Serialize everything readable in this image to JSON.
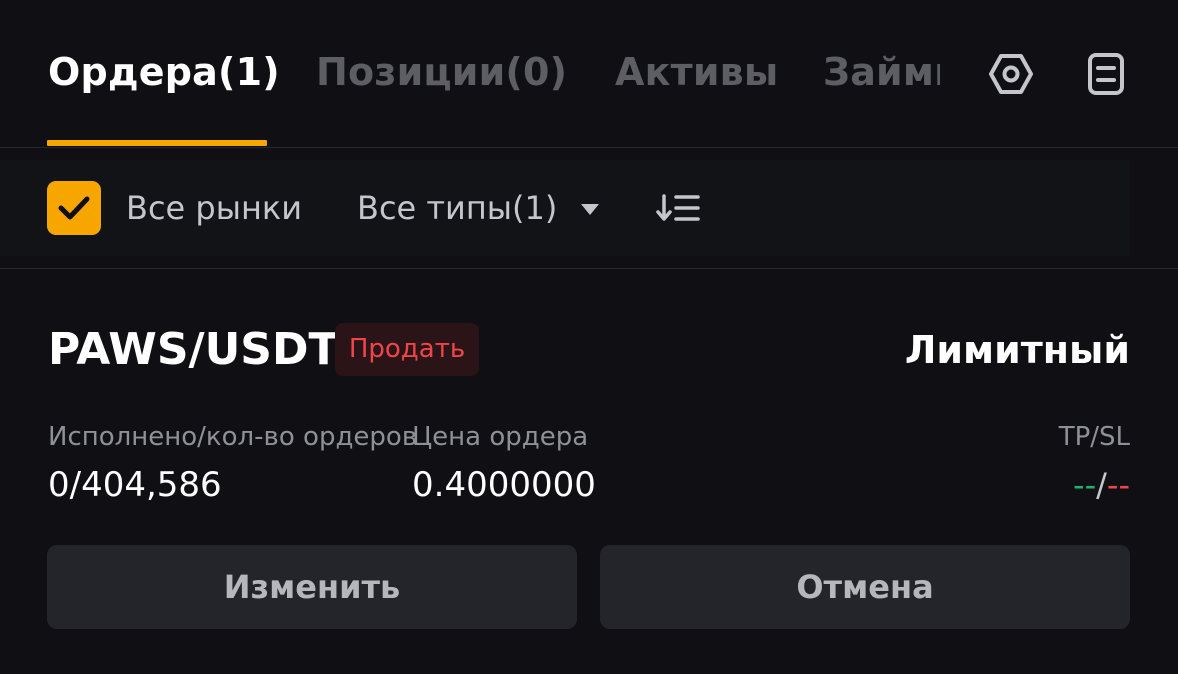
{
  "tabs": [
    {
      "label": "Ордера(1)",
      "active": true
    },
    {
      "label": "Позиции(0)",
      "active": false
    },
    {
      "label": "Активы",
      "active": false
    },
    {
      "label": "Займы",
      "active": false
    }
  ],
  "header_icons": [
    "settings-hex-icon",
    "document-icon"
  ],
  "filters": {
    "all_markets_checked": true,
    "all_markets_label": "Все рынки",
    "types_label": "Все типы(1)",
    "sort_icon": "sort-down-list-icon"
  },
  "order": {
    "pair": "PAWS/USDT",
    "side": "Продать",
    "type": "Лимитный",
    "filled_label": "Исполнено/кол-во ордеров",
    "filled_value": "0/404,586",
    "price_label": "Цена ордера",
    "price_value": "0.4000000",
    "tpsl_label": "TP/SL",
    "tp_value": "--",
    "tpsl_separator": "/",
    "sl_value": "--",
    "edit_label": "Изменить",
    "cancel_label": "Отмена"
  },
  "colors": {
    "background": "#101014",
    "accent": "#f7a600",
    "sell": "#ef454a",
    "buy": "#20b26c",
    "button_bg": "#23252a"
  }
}
